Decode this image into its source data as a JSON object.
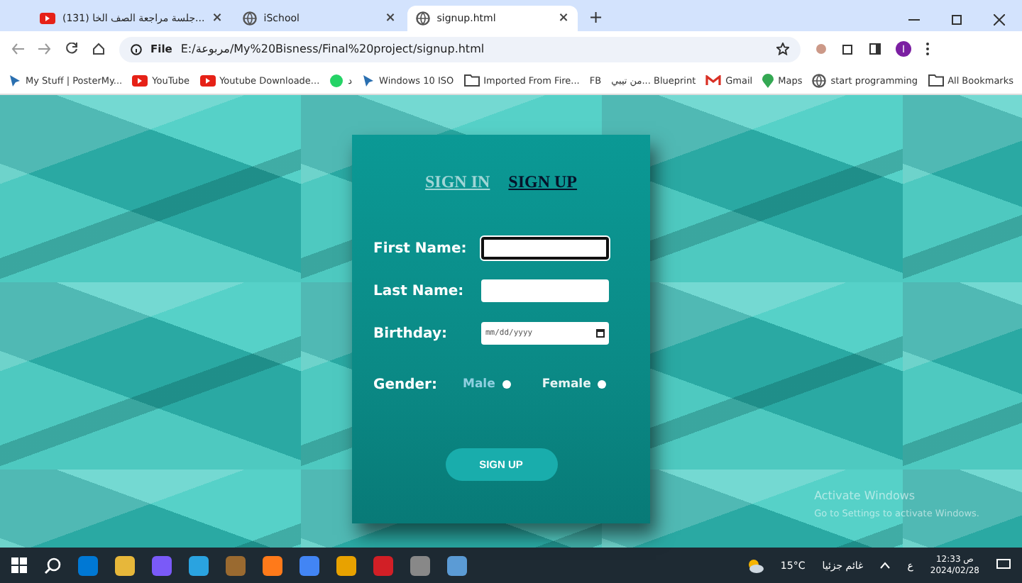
{
  "browser": {
    "tabs": [
      {
        "title": "(131) جلسة مراجعة الصف الخا...",
        "kind": "video",
        "close": "×",
        "selected": false
      },
      {
        "title": "iSchool",
        "kind": "globe",
        "close": "×",
        "selected": false
      },
      {
        "title": "signup.html",
        "kind": "globe",
        "close": "×",
        "selected": true
      }
    ],
    "new_tab": "+",
    "address": {
      "chip": "File",
      "url": "E:/مربوعة/My%20Bisness/Final%20project/signup.html"
    },
    "profile_initial": "I",
    "bookmarks": [
      {
        "label": "My Stuff | PosterMy...",
        "kind": "arrow"
      },
      {
        "label": "YouTube",
        "kind": "video"
      },
      {
        "label": "Youtube Downloade...",
        "kind": "video"
      },
      {
        "label": "د",
        "kind": "chat"
      },
      {
        "label": "Windows 10 ISO",
        "kind": "arrow"
      },
      {
        "label": "Imported From Fire...",
        "kind": "folder"
      },
      {
        "label": "FB",
        "kind": "plain"
      },
      {
        "label": "من تيبي... Blueprint",
        "kind": "plain"
      },
      {
        "label": "Gmail",
        "kind": "mail"
      },
      {
        "label": "Maps",
        "kind": "pin"
      },
      {
        "label": "start programming",
        "kind": "globe"
      }
    ],
    "all_bookmarks": "All Bookmarks"
  },
  "form": {
    "links": [
      {
        "label": "SIGN IN",
        "selected": false
      },
      {
        "label": "SIGN UP",
        "selected": true
      }
    ],
    "fields": [
      {
        "label": "First Name:",
        "kind": "text",
        "focused": true
      },
      {
        "label": "Last Name:",
        "kind": "text",
        "focused": false
      },
      {
        "label": "Birthday:",
        "kind": "date",
        "placeholder": "mm/dd/yyyy",
        "focused": false
      }
    ],
    "gender": {
      "label": "Gender:",
      "options": [
        {
          "label": "Male",
          "hovered": true,
          "selected": false
        },
        {
          "label": "Female",
          "hovered": false,
          "selected": false
        }
      ]
    },
    "submit": "SIGN UP"
  },
  "activation": {
    "title": "Activate Windows",
    "subtitle": "Go to Settings to activate Windows."
  },
  "taskbar": {
    "weather": {
      "temp": "15°C",
      "condition": "غائم جزئيا"
    },
    "language": "ع",
    "time": "12:33 ص",
    "date": "2024/02/28"
  }
}
